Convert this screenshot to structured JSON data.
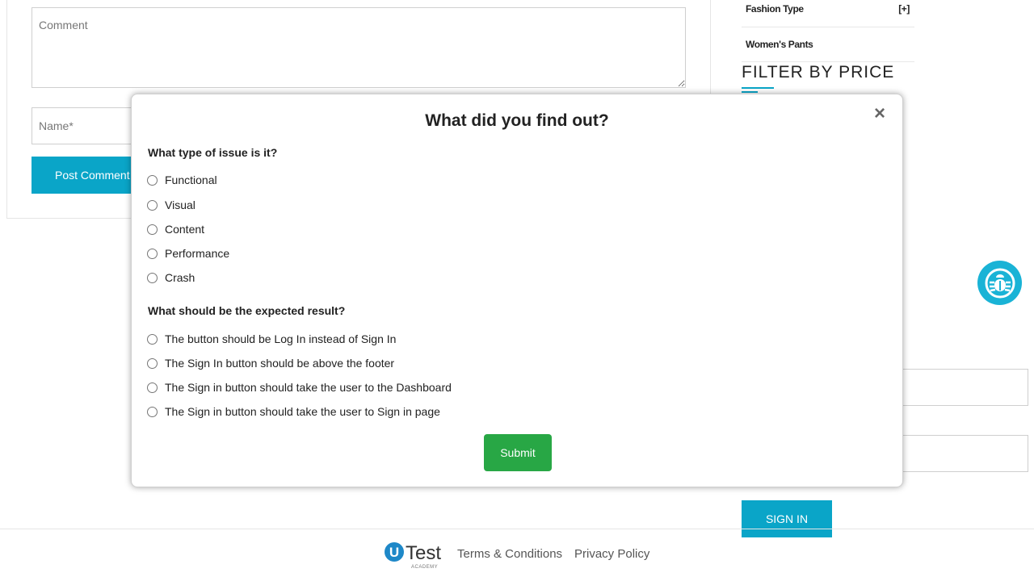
{
  "comment_form": {
    "comment_placeholder": "Comment",
    "name_placeholder": "Name*",
    "post_label": "Post Comment"
  },
  "sidebar": {
    "items": [
      {
        "label": "Fashion Type",
        "toggle": "[+]"
      },
      {
        "label": "Women's Pants"
      }
    ],
    "filter_title": "FILTER BY PRICE",
    "signin_label": "SIGN IN"
  },
  "modal": {
    "title": "What did you find out?",
    "close_glyph": "×",
    "questions": [
      {
        "label": "What type of issue is it?",
        "options": [
          "Functional",
          "Visual",
          "Content",
          "Performance",
          "Crash"
        ]
      },
      {
        "label": "What should be the expected result?",
        "options": [
          "The button should be Log In instead of Sign In",
          "The Sign In button should be above the footer",
          "The Sign in button should take the user to the Dashboard",
          "The Sign in button should take the user to Sign in page"
        ]
      }
    ],
    "submit_label": "Submit"
  },
  "footer": {
    "logo_letter": "U",
    "logo_word": "Test",
    "logo_sub": "ACADEMY",
    "links": [
      "Terms & Conditions",
      "Privacy Policy"
    ]
  },
  "colors": {
    "accent": "#0aa5c8",
    "submit": "#28a745",
    "bug_fab": "#1ab3d6",
    "logo_blue": "#1e88c8"
  },
  "icons": {
    "bug_fab": "bug-icon",
    "close": "close-icon"
  }
}
